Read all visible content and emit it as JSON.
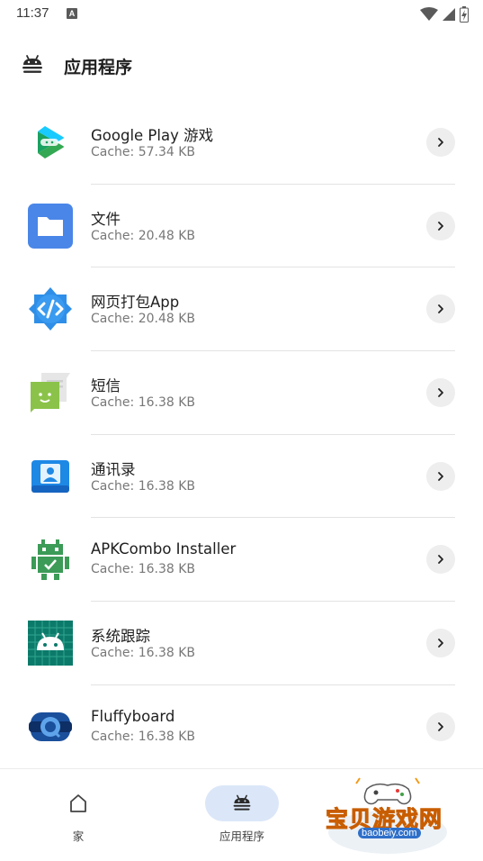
{
  "status_bar": {
    "time": "11:37",
    "notif_letter": "A"
  },
  "app_bar": {
    "title": "应用程序",
    "icon": "android-icon"
  },
  "apps": [
    {
      "name": "Google Play 游戏",
      "cache": "Cache: 57.34 KB",
      "icon": "google-play-games-icon"
    },
    {
      "name": "文件",
      "cache": "Cache: 20.48 KB",
      "icon": "files-icon"
    },
    {
      "name": "网页打包App",
      "cache": "Cache: 20.48 KB",
      "icon": "web-packager-icon"
    },
    {
      "name": "短信",
      "cache": "Cache: 16.38 KB",
      "icon": "sms-icon"
    },
    {
      "name": "通讯录",
      "cache": "Cache: 16.38 KB",
      "icon": "contacts-icon"
    },
    {
      "name": "APKCombo Installer",
      "cache": "Cache: 16.38 KB",
      "icon": "apkcombo-icon"
    },
    {
      "name": "系统跟踪",
      "cache": "Cache: 16.38 KB",
      "icon": "system-tracing-icon"
    },
    {
      "name": "Fluffyboard",
      "cache": "Cache: 16.38 KB",
      "icon": "fluffyboard-icon"
    }
  ],
  "bottom_nav": {
    "items": [
      {
        "label": "家",
        "icon": "home-icon",
        "selected": false
      },
      {
        "label": "应用程序",
        "icon": "android-icon",
        "selected": true
      }
    ]
  },
  "watermark": {
    "text": "宝贝游戏网",
    "url": "baobeiy.com"
  },
  "colors": {
    "accent_pill": "#dbe7f8",
    "divider": "#e3e3e3",
    "secondary_text": "#777777"
  }
}
